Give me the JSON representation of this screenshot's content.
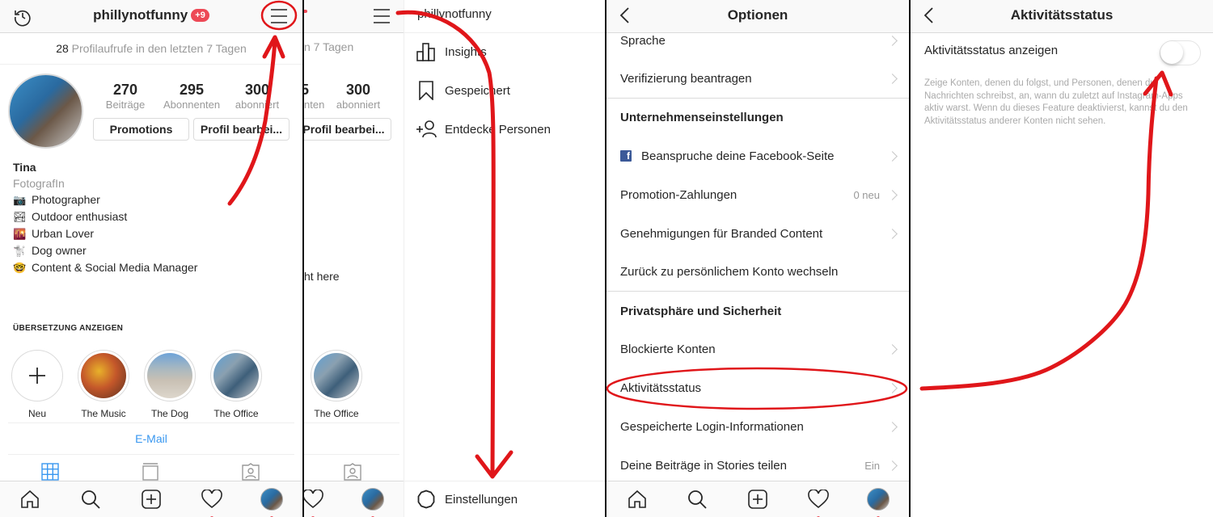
{
  "profile": {
    "username": "phillynotfunny",
    "notification_badge": "+9",
    "views_count": "28",
    "views_text": "Profilaufrufe in den letzten 7 Tagen",
    "stats": [
      {
        "value": "270",
        "label": "Beiträge"
      },
      {
        "value": "295",
        "label": "Abonnenten"
      },
      {
        "value": "300",
        "label": "abonniert"
      }
    ],
    "buttons": {
      "promotions": "Promotions",
      "edit_profile": "Profil bearbei..."
    },
    "name": "Tina",
    "category": "FotografIn",
    "bio_lines": [
      {
        "emoji": "📷",
        "text": "Photographer"
      },
      {
        "emoji": "🏞",
        "text": "Outdoor enthusiast"
      },
      {
        "emoji": "🌇",
        "text": "Urban Lover"
      },
      {
        "emoji": "🐩",
        "text": "Dog owner"
      },
      {
        "emoji": "🤓",
        "text": "Content & Social Media Manager"
      }
    ],
    "translate_label": "ÜBERSETZUNG ANZEIGEN",
    "highlights": [
      {
        "label": "Neu",
        "icon": "plus-icon"
      },
      {
        "label": "The Music"
      },
      {
        "label": "The Dog"
      },
      {
        "label": "The Office"
      }
    ],
    "email_label": "E-Mail",
    "content_tabs": [
      "grid-icon",
      "igtv-icon",
      "tagged-icon"
    ]
  },
  "menu": {
    "username": "phillynotfunny",
    "background_partial": {
      "views": "n 7 Tagen",
      "stat_value": "300",
      "stat_label": "abonniert",
      "stat_partial_label": "nten",
      "edit_button": "Profil bearbei...",
      "bio_fragment": "ht here",
      "highlight_label": "The Office"
    },
    "items": [
      {
        "label": "Insights",
        "icon": "insights-icon"
      },
      {
        "label": "Gespeichert",
        "icon": "bookmark-icon"
      },
      {
        "label": "Entdecke Personen",
        "icon": "add-person-icon"
      }
    ],
    "footer_label": "Einstellungen"
  },
  "options": {
    "title": "Optionen",
    "rows": [
      {
        "label": "Sprache",
        "chevron": true
      },
      {
        "label": "Verifizierung beantragen",
        "chevron": true
      },
      {
        "label": "Unternehmenseinstellungen",
        "section": true
      },
      {
        "label": "Beanspruche deine Facebook-Seite",
        "chevron": true,
        "icon": "facebook-icon"
      },
      {
        "label": "Promotion-Zahlungen",
        "value": "0 neu",
        "chevron": true
      },
      {
        "label": "Genehmigungen für Branded Content",
        "chevron": true
      },
      {
        "label": "Zurück zu persönlichem Konto wechseln"
      },
      {
        "label": "Privatsphäre und Sicherheit",
        "section": true
      },
      {
        "label": "Blockierte Konten",
        "chevron": true
      },
      {
        "label": "Aktivitätsstatus",
        "chevron": true,
        "highlighted": true
      },
      {
        "label": "Gespeicherte Login-Informationen",
        "chevron": true
      },
      {
        "label": "Deine Beiträge in Stories teilen",
        "value": "Ein",
        "chevron": true
      }
    ]
  },
  "activity": {
    "title": "Aktivitätsstatus",
    "toggle_label": "Aktivitätsstatus anzeigen",
    "toggle_on": false,
    "description": "Zeige Konten, denen du folgst, und Personen, denen du Nachrichten schreibst, an, wann du zuletzt auf Instagram-Apps aktiv warst. Wenn du dieses Feature deaktivierst, kannst du den Aktivitätsstatus anderer Konten nicht sehen."
  },
  "bottom_nav": [
    "home-icon",
    "search-icon",
    "new-post-icon",
    "activity-heart-icon",
    "profile-avatar"
  ],
  "colors": {
    "annotation_red": "#e0161a",
    "badge_red": "#ed4956",
    "link_blue": "#3897f0",
    "facebook_blue": "#3b5998"
  }
}
